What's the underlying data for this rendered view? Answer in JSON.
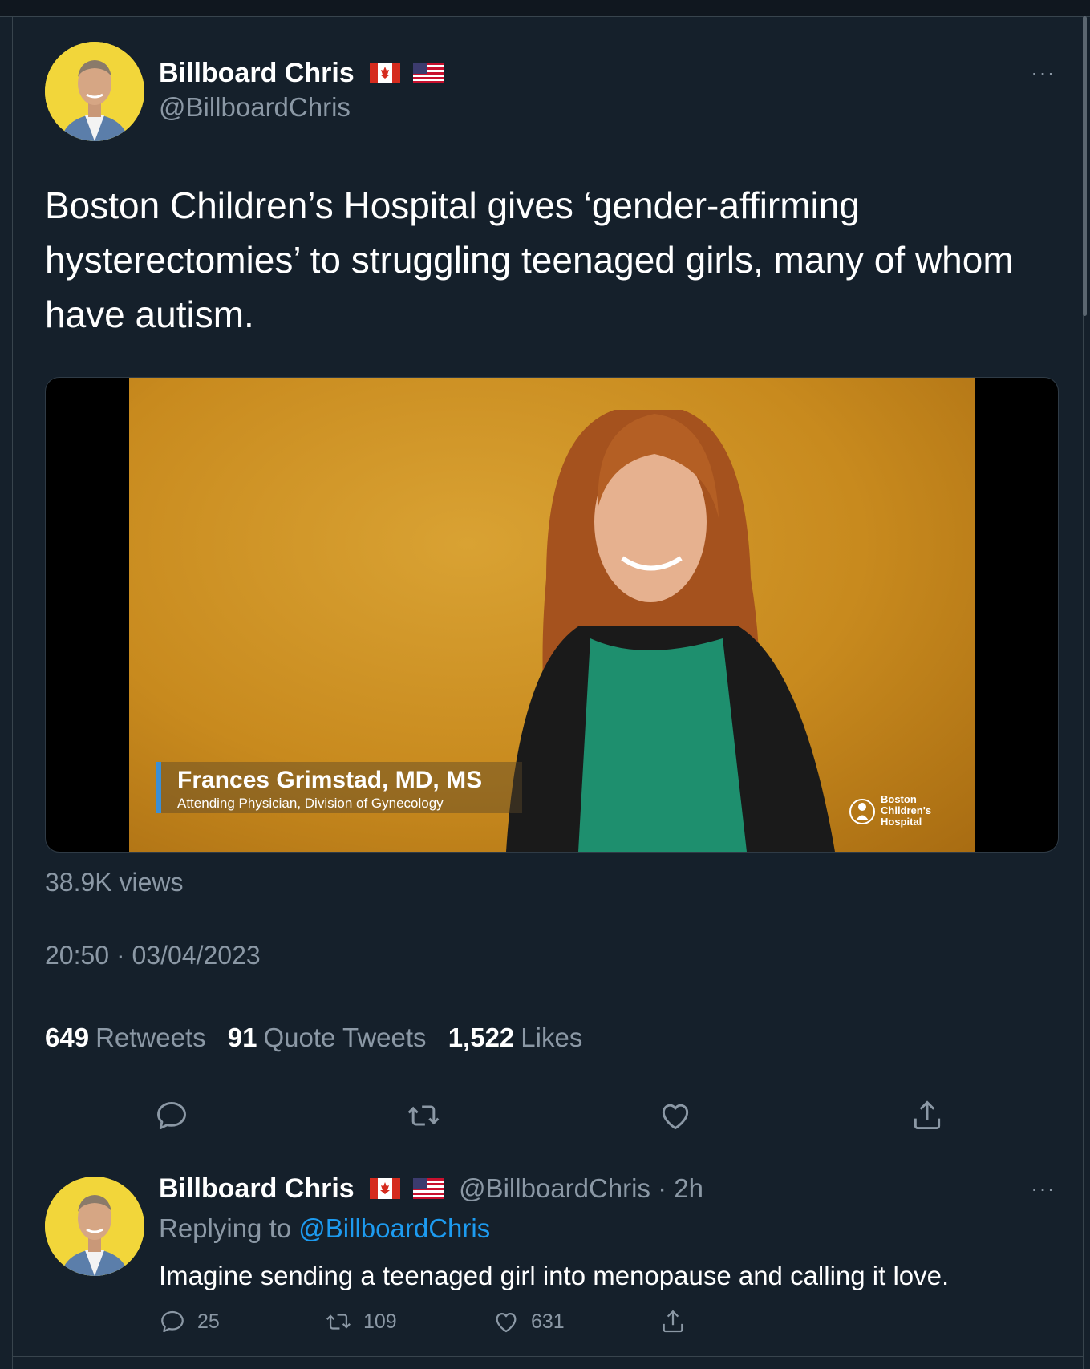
{
  "tweet": {
    "author_name": "Billboard Chris",
    "author_handle": "@BillboardChris",
    "text": "Boston Children’s Hospital gives ‘gender-affirming hysterectomies’ to struggling teenaged girls, many of whom have autism.",
    "media": {
      "lower_third_name": "Frances Grimstad, MD, MS",
      "lower_third_title": "Attending Physician, Division of Gynecology",
      "logo_line1": "Boston",
      "logo_line2": "Children's",
      "logo_line3": "Hospital"
    },
    "views": "38.9K views",
    "timestamp": "20:50 · 03/04/2023",
    "stats": {
      "retweets_count": "649",
      "retweets_label": "Retweets",
      "quotes_count": "91",
      "quotes_label": "Quote Tweets",
      "likes_count": "1,522",
      "likes_label": "Likes"
    },
    "more_label": "···"
  },
  "reply": {
    "author_name": "Billboard Chris",
    "handle_time": "@BillboardChris · 2h",
    "replying_label": "Replying to",
    "replying_handle": "@BillboardChris",
    "text": "Imagine sending a teenaged girl into menopause and calling it love.",
    "reply_count": "25",
    "retweet_count": "109",
    "like_count": "631",
    "more_label": "···"
  },
  "colors": {
    "background": "#15202b",
    "secondary_text": "#8b98a5",
    "link": "#1d9bf0",
    "divider": "#38444d"
  },
  "icons": [
    "reply-icon",
    "retweet-icon",
    "like-icon",
    "share-icon",
    "more-icon",
    "canada-flag-icon",
    "us-flag-icon"
  ]
}
